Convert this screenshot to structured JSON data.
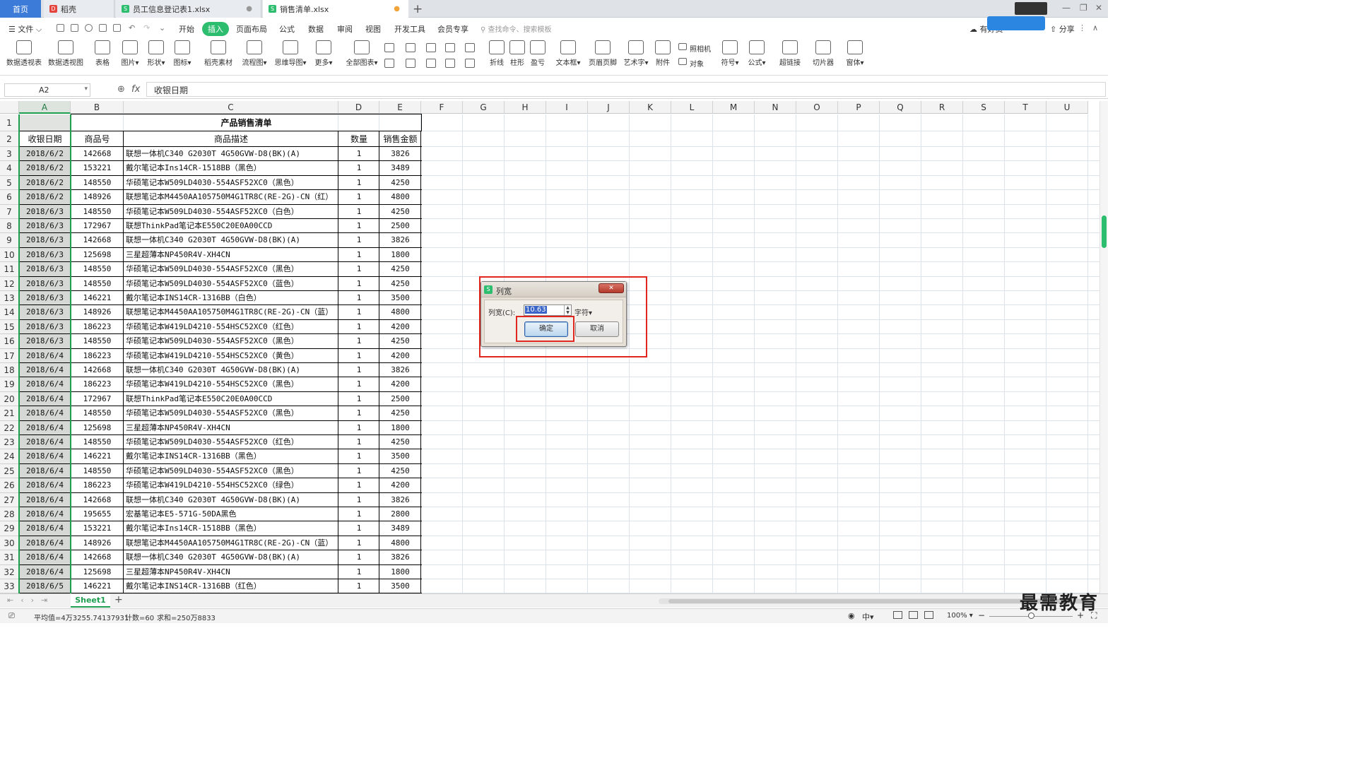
{
  "tabs": {
    "home": "首页",
    "t1": "稻壳",
    "t2": "员工信息登记表1.xlsx",
    "t3": "销售清单.xlsx"
  },
  "menu": {
    "file": "文件",
    "items": [
      "开始",
      "插入",
      "页面布局",
      "公式",
      "数据",
      "审阅",
      "视图",
      "开发工具",
      "会员专享"
    ],
    "active": "插入",
    "search": "查找命令、搜索模板",
    "share": "分享",
    "blue_badge": "有好资"
  },
  "ribbon": [
    {
      "label": "数据透视表",
      "icon": "pivot-table-icon"
    },
    {
      "label": "数据透视图",
      "icon": "pivot-chart-icon"
    },
    {
      "label": "表格",
      "icon": "table-icon"
    },
    {
      "label": "图片▾",
      "icon": "picture-icon"
    },
    {
      "label": "形状▾",
      "icon": "shape-icon"
    },
    {
      "label": "图标▾",
      "icon": "icons-icon"
    },
    {
      "label": "稻壳素材",
      "icon": "docer-material-icon"
    },
    {
      "label": "流程图▾",
      "icon": "flowchart-icon"
    },
    {
      "label": "思维导图▾",
      "icon": "mindmap-icon"
    },
    {
      "label": "更多▾",
      "icon": "more-icon"
    },
    {
      "label": "全部图表▾",
      "icon": "all-charts-icon"
    },
    {
      "label": "折线",
      "icon": "sparkline-line-icon"
    },
    {
      "label": "柱形",
      "icon": "sparkline-column-icon"
    },
    {
      "label": "盈亏",
      "icon": "sparkline-winloss-icon"
    },
    {
      "label": "文本框▾",
      "icon": "textbox-icon"
    },
    {
      "label": "页眉页脚",
      "icon": "header-footer-icon"
    },
    {
      "label": "艺术字▾",
      "icon": "wordart-icon"
    },
    {
      "label": "附件",
      "icon": "attachment-icon"
    },
    {
      "label": "符号▾",
      "icon": "symbol-icon"
    },
    {
      "label": "公式▾",
      "icon": "equation-icon"
    },
    {
      "label": "超链接",
      "icon": "hyperlink-icon"
    },
    {
      "label": "切片器",
      "icon": "slicer-icon"
    },
    {
      "label": "窗体▾",
      "icon": "form-icon"
    }
  ],
  "ribbon_small": {
    "camera": "照相机",
    "object": "对象"
  },
  "formula": {
    "namebox": "A2",
    "fx": "fx",
    "value": "收银日期"
  },
  "columns": [
    "A",
    "B",
    "C",
    "D",
    "E",
    "F",
    "G",
    "H",
    "I",
    "J",
    "K",
    "L",
    "M",
    "N",
    "O",
    "P",
    "Q",
    "R",
    "S",
    "T",
    "U"
  ],
  "sheet": {
    "title": "产品销售清单",
    "headers": [
      "收银日期",
      "商品号",
      "商品描述",
      "数量",
      "销售金额"
    ],
    "rows": [
      [
        "2018/6/2",
        "142668",
        "联想一体机C340 G2030T 4G50GVW-D8(BK)(A)",
        "1",
        "3826"
      ],
      [
        "2018/6/2",
        "153221",
        "戴尔笔记本Ins14CR-1518BB（黑色）",
        "1",
        "3489"
      ],
      [
        "2018/6/2",
        "148550",
        "华硕笔记本W509LD4030-554ASF52XC0（黑色）",
        "1",
        "4250"
      ],
      [
        "2018/6/2",
        "148926",
        "联想笔记本M4450AA105750M4G1TR8C(RE-2G)-CN（红）",
        "1",
        "4800"
      ],
      [
        "2018/6/3",
        "148550",
        "华硕笔记本W509LD4030-554ASF52XC0（白色）",
        "1",
        "4250"
      ],
      [
        "2018/6/3",
        "172967",
        "联想ThinkPad笔记本E550C20E0A00CCD",
        "1",
        "2500"
      ],
      [
        "2018/6/3",
        "142668",
        "联想一体机C340 G2030T 4G50GVW-D8(BK)(A)",
        "1",
        "3826"
      ],
      [
        "2018/6/3",
        "125698",
        "三星超薄本NP450R4V-XH4CN",
        "1",
        "1800"
      ],
      [
        "2018/6/3",
        "148550",
        "华硕笔记本W509LD4030-554ASF52XC0（黑色）",
        "1",
        "4250"
      ],
      [
        "2018/6/3",
        "148550",
        "华硕笔记本W509LD4030-554ASF52XC0（蓝色）",
        "1",
        "4250"
      ],
      [
        "2018/6/3",
        "146221",
        "戴尔笔记本INS14CR-1316BB（白色）",
        "1",
        "3500"
      ],
      [
        "2018/6/3",
        "148926",
        "联想笔记本M4450AA105750M4G1TR8C(RE-2G)-CN（蓝）",
        "1",
        "4800"
      ],
      [
        "2018/6/3",
        "186223",
        "华硕笔记本W419LD4210-554HSC52XC0（红色）",
        "1",
        "4200"
      ],
      [
        "2018/6/3",
        "148550",
        "华硕笔记本W509LD4030-554ASF52XC0（黑色）",
        "1",
        "4250"
      ],
      [
        "2018/6/4",
        "186223",
        "华硕笔记本W419LD4210-554HSC52XC0（黄色）",
        "1",
        "4200"
      ],
      [
        "2018/6/4",
        "142668",
        "联想一体机C340 G2030T 4G50GVW-D8(BK)(A)",
        "1",
        "3826"
      ],
      [
        "2018/6/4",
        "186223",
        "华硕笔记本W419LD4210-554HSC52XC0（黑色）",
        "1",
        "4200"
      ],
      [
        "2018/6/4",
        "172967",
        "联想ThinkPad笔记本E550C20E0A00CCD",
        "1",
        "2500"
      ],
      [
        "2018/6/4",
        "148550",
        "华硕笔记本W509LD4030-554ASF52XC0（黑色）",
        "1",
        "4250"
      ],
      [
        "2018/6/4",
        "125698",
        "三星超薄本NP450R4V-XH4CN",
        "1",
        "1800"
      ],
      [
        "2018/6/4",
        "148550",
        "华硕笔记本W509LD4030-554ASF52XC0（红色）",
        "1",
        "4250"
      ],
      [
        "2018/6/4",
        "146221",
        "戴尔笔记本INS14CR-1316BB（黑色）",
        "1",
        "3500"
      ],
      [
        "2018/6/4",
        "148550",
        "华硕笔记本W509LD4030-554ASF52XC0（黑色）",
        "1",
        "4250"
      ],
      [
        "2018/6/4",
        "186223",
        "华硕笔记本W419LD4210-554HSC52XC0（绿色）",
        "1",
        "4200"
      ],
      [
        "2018/6/4",
        "142668",
        "联想一体机C340 G2030T 4G50GVW-D8(BK)(A)",
        "1",
        "3826"
      ],
      [
        "2018/6/4",
        "195655",
        "宏基笔记本E5-571G-50DA黑色",
        "1",
        "2800"
      ],
      [
        "2018/6/4",
        "153221",
        "戴尔笔记本Ins14CR-1518BB（黑色）",
        "1",
        "3489"
      ],
      [
        "2018/6/4",
        "148926",
        "联想笔记本M4450AA105750M4G1TR8C(RE-2G)-CN（蓝）",
        "1",
        "4800"
      ],
      [
        "2018/6/4",
        "142668",
        "联想一体机C340 G2030T 4G50GVW-D8(BK)(A)",
        "1",
        "3826"
      ],
      [
        "2018/6/4",
        "125698",
        "三星超薄本NP450R4V-XH4CN",
        "1",
        "1800"
      ],
      [
        "2018/6/5",
        "146221",
        "戴尔笔记本INS14CR-1316BB（红色）",
        "1",
        "3500"
      ]
    ]
  },
  "dialog": {
    "title": "列宽",
    "label": "列宽(C):",
    "value": "10.63",
    "unit": "字符▾",
    "ok": "确定",
    "cancel": "取消"
  },
  "sheettab": "Sheet1",
  "status": {
    "avg": "平均值=4万3255.74137931",
    "count": "计数=60",
    "sum": "求和=250万8833",
    "zoom": "100%"
  },
  "watermark": "最需教育",
  "colors": {
    "accent": "#2dbd6e",
    "tab_active": "#3d7bd8",
    "highlight_red": "#e0261f"
  }
}
